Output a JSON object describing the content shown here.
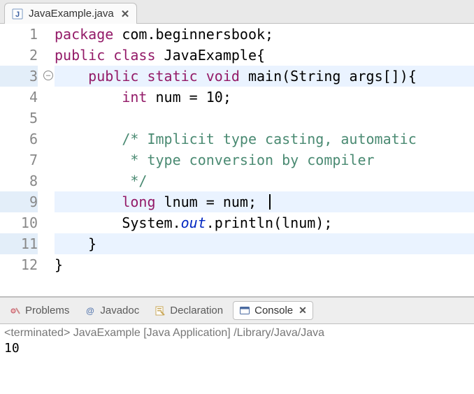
{
  "tab": {
    "label": "JavaExample.java"
  },
  "code": {
    "lines": [
      {
        "n": 1,
        "tokens": [
          {
            "t": "package ",
            "c": "kw"
          },
          {
            "t": "com.beginnersbook;",
            "c": "pkg"
          }
        ]
      },
      {
        "n": 2,
        "tokens": [
          {
            "t": "public class ",
            "c": "kw"
          },
          {
            "t": "JavaExample{",
            "c": "pkg"
          }
        ]
      },
      {
        "n": 3,
        "fold": true,
        "hl": true,
        "tokens": [
          {
            "t": "    ",
            "c": "pkg"
          },
          {
            "t": "public static void ",
            "c": "kw"
          },
          {
            "t": "main(String args[]){",
            "c": "pkg"
          }
        ]
      },
      {
        "n": 4,
        "tokens": [
          {
            "t": "        ",
            "c": "pkg"
          },
          {
            "t": "int ",
            "c": "kw"
          },
          {
            "t": "num = 10;",
            "c": "pkg"
          }
        ]
      },
      {
        "n": 5,
        "tokens": []
      },
      {
        "n": 6,
        "tokens": [
          {
            "t": "        ",
            "c": "pkg"
          },
          {
            "t": "/* Implicit type casting, automatic",
            "c": "com"
          }
        ]
      },
      {
        "n": 7,
        "tokens": [
          {
            "t": "        ",
            "c": "pkg"
          },
          {
            "t": " * type conversion by compiler",
            "c": "com"
          }
        ]
      },
      {
        "n": 8,
        "tokens": [
          {
            "t": "        ",
            "c": "pkg"
          },
          {
            "t": " */",
            "c": "com"
          }
        ]
      },
      {
        "n": 9,
        "hl": true,
        "cursor": true,
        "tokens": [
          {
            "t": "        ",
            "c": "pkg"
          },
          {
            "t": "long ",
            "c": "kw"
          },
          {
            "t": "lnum = num; ",
            "c": "pkg"
          }
        ]
      },
      {
        "n": 10,
        "tokens": [
          {
            "t": "        System.",
            "c": "pkg"
          },
          {
            "t": "out",
            "c": "static-it"
          },
          {
            "t": ".println(lnum);",
            "c": "pkg"
          }
        ]
      },
      {
        "n": 11,
        "hl": true,
        "tokens": [
          {
            "t": "    }",
            "c": "pkg"
          }
        ]
      },
      {
        "n": 12,
        "tokens": [
          {
            "t": "}",
            "c": "pkg"
          }
        ]
      }
    ]
  },
  "panel": {
    "tabs": {
      "problems": "Problems",
      "javadoc": "Javadoc",
      "declaration": "Declaration",
      "console": "Console"
    },
    "status": "<terminated> JavaExample [Java Application] /Library/Java/Java",
    "output": "10"
  }
}
